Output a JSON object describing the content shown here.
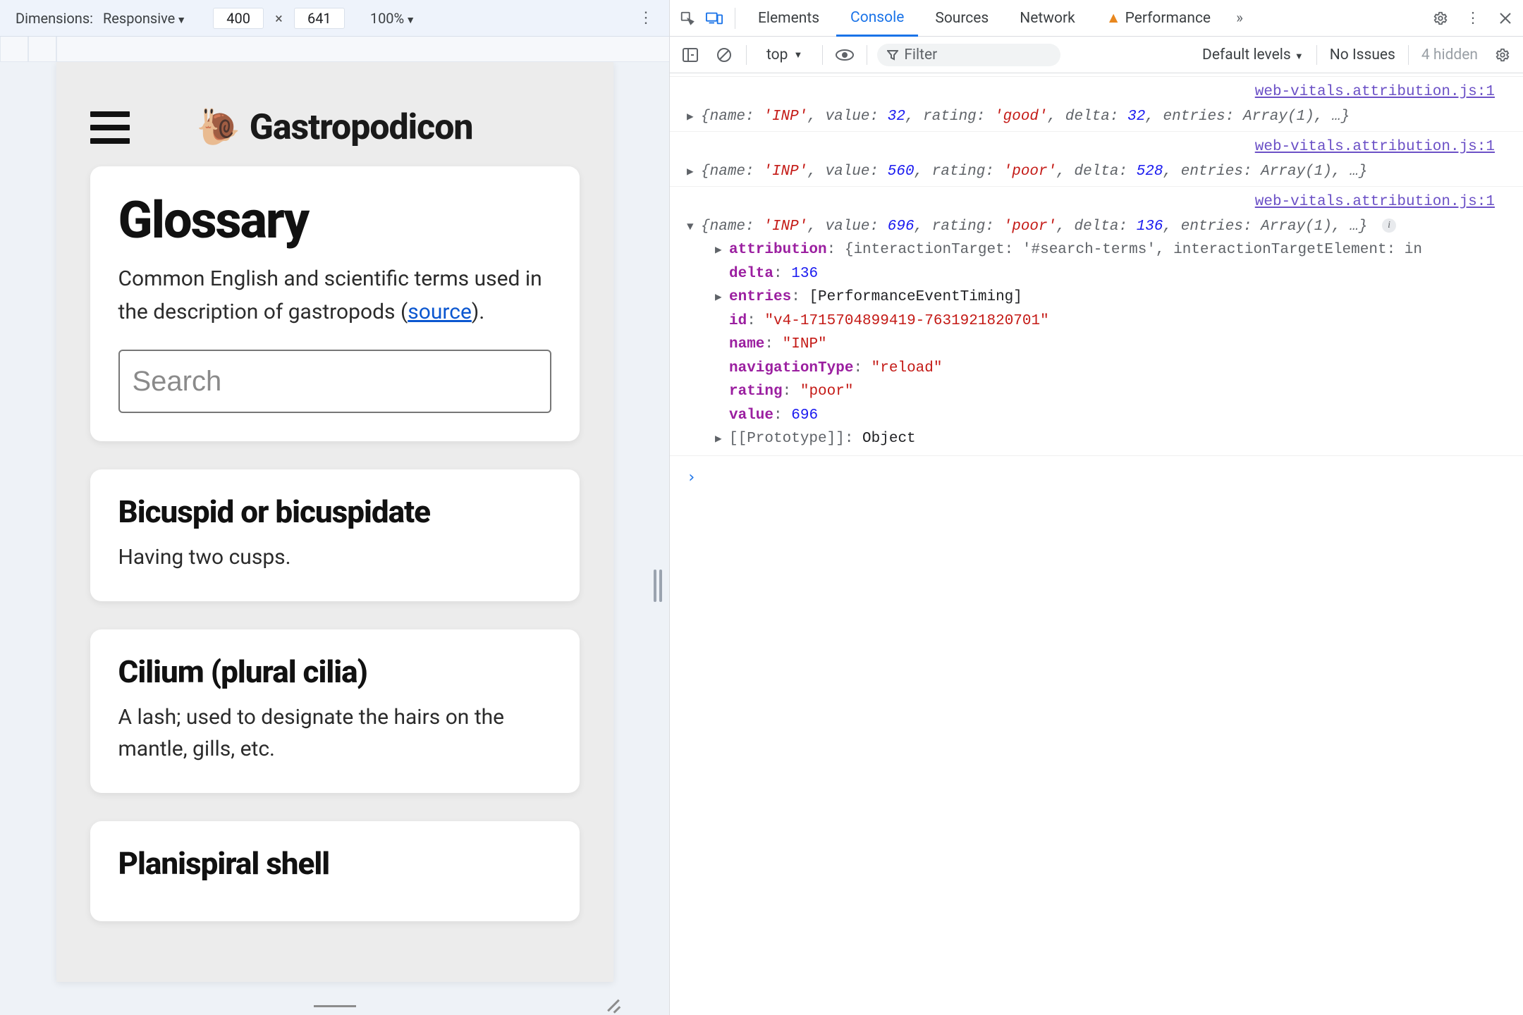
{
  "deviceBar": {
    "dimensionsLabel": "Dimensions:",
    "deviceName": "Responsive",
    "width": "400",
    "height": "641",
    "zoom": "100%"
  },
  "app": {
    "brand": "Gastropodicon",
    "glossary": {
      "title": "Glossary",
      "intro_pre": "Common English and scientific terms used in the description of gastropods (",
      "intro_link": "source",
      "intro_post": ").",
      "search_placeholder": "Search"
    },
    "entries": [
      {
        "term": "Bicuspid or bicuspidate",
        "def": "Having two cusps."
      },
      {
        "term": "Cilium (plural cilia)",
        "def": "A lash; used to designate the hairs on the mantle, gills, etc."
      },
      {
        "term": "Planispiral shell",
        "def": ""
      }
    ]
  },
  "devtools": {
    "tabs": {
      "elements": "Elements",
      "console": "Console",
      "sources": "Sources",
      "network": "Network",
      "performance": "Performance"
    },
    "filter": {
      "context": "top",
      "filter_placeholder": "Filter",
      "levels": "Default levels",
      "noIssues": "No Issues",
      "hidden": "4 hidden"
    },
    "sourceLink": "web-vitals.attribution.js:1",
    "logs": [
      {
        "expanded": false,
        "summary": "{name: 'INP', value: 32, rating: 'good', delta: 32, entries: Array(1), …}",
        "name": "INP",
        "value": 32,
        "rating": "good",
        "delta": 32
      },
      {
        "expanded": false,
        "summary": "{name: 'INP', value: 560, rating: 'poor', delta: 528, entries: Array(1), …}",
        "name": "INP",
        "value": 560,
        "rating": "poor",
        "delta": 528
      },
      {
        "expanded": true,
        "summary": "{name: 'INP', value: 696, rating: 'poor', delta: 136, entries: Array(1), …}",
        "name": "INP",
        "value": 696,
        "rating": "poor",
        "delta": 136,
        "props": {
          "attribution_summary": "{interactionTarget: '#search-terms', interactionTargetElement: in",
          "delta": 136,
          "entries": "[PerformanceEventTiming]",
          "id": "\"v4-1715704899419-7631921820701\"",
          "pname": "\"INP\"",
          "navigationType": "\"reload\"",
          "rating": "\"poor\"",
          "pvalue": 696,
          "prototype": "Object"
        }
      }
    ],
    "promptGlyph": "›"
  }
}
